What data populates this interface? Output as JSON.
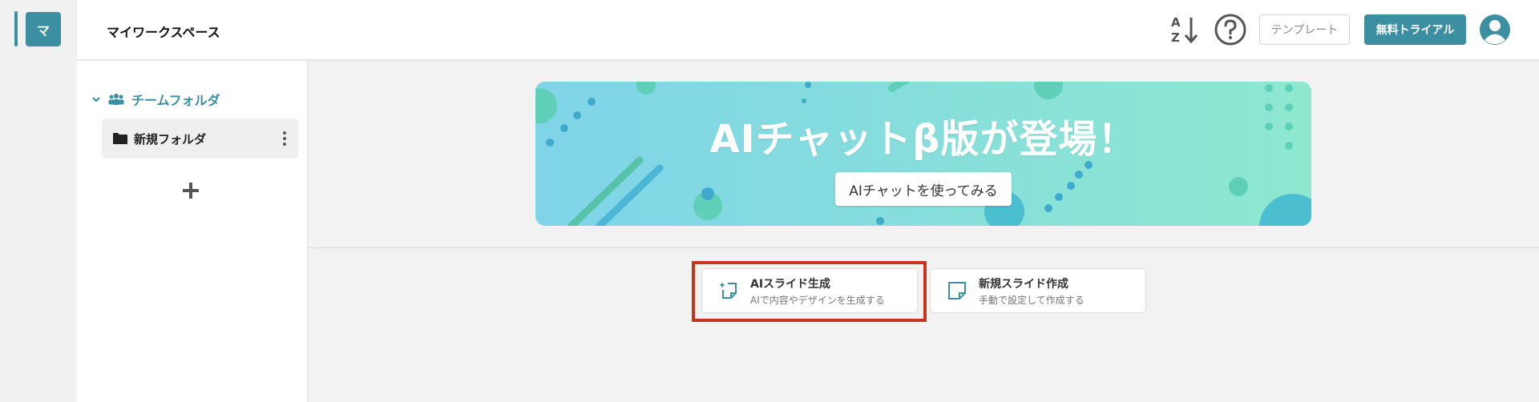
{
  "rail": {
    "workspace_initial": "マ"
  },
  "header": {
    "title": "マイワークスペース",
    "template_label": "テンプレート",
    "trial_label": "無料トライアル"
  },
  "sidebar": {
    "team_folder_label": "チームフォルダ",
    "folders": [
      {
        "label": "新規フォルダ"
      }
    ]
  },
  "banner": {
    "title": "AIチャットβ版が登場！",
    "button_label": "AIチャットを使ってみる"
  },
  "actions": [
    {
      "title": "AIスライド生成",
      "subtitle": "AIで内容やデザインを生成する"
    },
    {
      "title": "新規スライド作成",
      "subtitle": "手動で設定して作成する"
    }
  ],
  "colors": {
    "accent": "#3c8fa0",
    "highlight": "#c8331f",
    "banner_start": "#7fd4e8",
    "banner_end": "#8ee8cf"
  },
  "icons": [
    "sort-alpha-icon",
    "help-icon",
    "user-avatar-icon",
    "chevron-down-icon",
    "team-icon",
    "folder-icon",
    "more-vert-icon",
    "plus-icon",
    "ai-slide-icon",
    "new-slide-icon"
  ]
}
